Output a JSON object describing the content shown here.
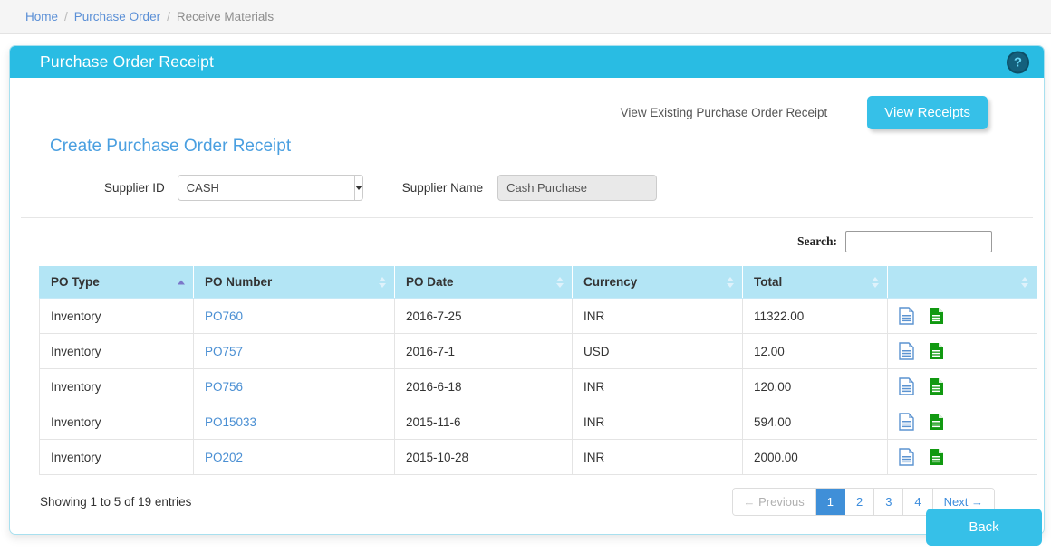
{
  "breadcrumb": {
    "home": "Home",
    "section": "Purchase Order",
    "current": "Receive Materials",
    "separator": "/"
  },
  "panel": {
    "title": "Purchase Order Receipt",
    "help_icon_glyph": "?"
  },
  "top": {
    "view_existing_label": "View Existing Purchase Order Receipt",
    "view_receipts_button": "View Receipts",
    "section_title": "Create Purchase Order Receipt",
    "supplier_id_label": "Supplier ID",
    "supplier_id_value": "CASH",
    "supplier_name_label": "Supplier Name",
    "supplier_name_value": "Cash Purchase"
  },
  "search": {
    "label": "Search:",
    "value": "",
    "placeholder": ""
  },
  "table": {
    "columns": [
      {
        "label": "PO Type",
        "sort": "asc"
      },
      {
        "label": "PO Number",
        "sort": "none"
      },
      {
        "label": "PO Date",
        "sort": "none"
      },
      {
        "label": "Currency",
        "sort": "none"
      },
      {
        "label": "Total",
        "sort": "none"
      },
      {
        "label": "",
        "sort": "none"
      }
    ],
    "rows": [
      {
        "po_type": "Inventory",
        "po_number": "PO760",
        "po_date": "2016-7-25",
        "currency": "INR",
        "total": "11322.00"
      },
      {
        "po_type": "Inventory",
        "po_number": "PO757",
        "po_date": "2016-7-1",
        "currency": "USD",
        "total": "12.00"
      },
      {
        "po_type": "Inventory",
        "po_number": "PO756",
        "po_date": "2016-6-18",
        "currency": "INR",
        "total": "120.00"
      },
      {
        "po_type": "Inventory",
        "po_number": "PO15033",
        "po_date": "2015-11-6",
        "currency": "INR",
        "total": "594.00"
      },
      {
        "po_type": "Inventory",
        "po_number": "PO202",
        "po_date": "2015-10-28",
        "currency": "INR",
        "total": "2000.00"
      }
    ],
    "row_action_icons": [
      "document-view-icon",
      "document-export-icon"
    ]
  },
  "footer": {
    "showing_info": "Showing 1 to 5 of 19 entries",
    "pagination": {
      "previous": "← Previous",
      "pages": [
        "1",
        "2",
        "3",
        "4"
      ],
      "active_page": "1",
      "next": "Next →"
    }
  },
  "actions": {
    "back_button": "Back"
  },
  "colors": {
    "accent": "#29bce3",
    "button": "#36c0e8",
    "table_header": "#b3e5f5",
    "link": "#4a8fd3",
    "section_title": "#4a9fe0",
    "pagination_active": "#3f8fd8",
    "icon_blue": "#5b93d1",
    "icon_green": "#119911"
  }
}
